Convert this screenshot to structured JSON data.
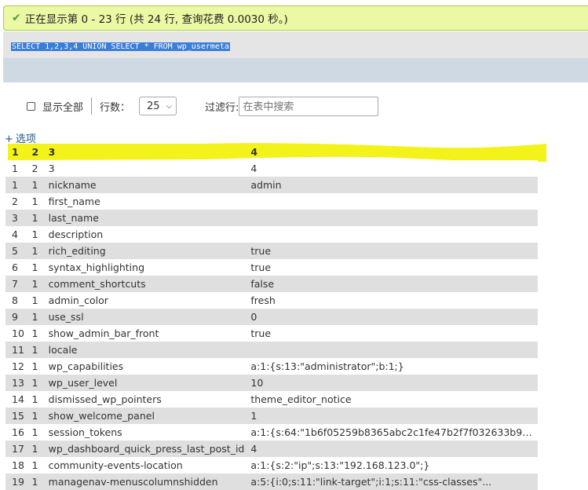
{
  "status": {
    "message": "正在显示第 0 - 23 行 (共 24 行, 查询花费 0.0030 秒。)"
  },
  "query": {
    "sql": "SELECT 1,2,3,4 UNION SELECT * FROM wp_usermeta"
  },
  "controls": {
    "show_all_label": "显示全部",
    "rows_label": "行数：",
    "rows_value": "25",
    "filter_label": "过滤行:",
    "filter_placeholder": "在表中搜索"
  },
  "options_link": {
    "plus": "+",
    "label": "选项"
  },
  "table": {
    "columns": [
      "1",
      "2",
      "3",
      "4"
    ],
    "rows": [
      [
        "1",
        "2",
        "3",
        "4"
      ],
      [
        "1",
        "1",
        "nickname",
        "admin"
      ],
      [
        "2",
        "1",
        "first_name",
        ""
      ],
      [
        "3",
        "1",
        "last_name",
        ""
      ],
      [
        "4",
        "1",
        "description",
        ""
      ],
      [
        "5",
        "1",
        "rich_editing",
        "true"
      ],
      [
        "6",
        "1",
        "syntax_highlighting",
        "true"
      ],
      [
        "7",
        "1",
        "comment_shortcuts",
        "false"
      ],
      [
        "8",
        "1",
        "admin_color",
        "fresh"
      ],
      [
        "9",
        "1",
        "use_ssl",
        "0"
      ],
      [
        "10",
        "1",
        "show_admin_bar_front",
        "true"
      ],
      [
        "11",
        "1",
        "locale",
        ""
      ],
      [
        "12",
        "1",
        "wp_capabilities",
        "a:1:{s:13:\"administrator\";b:1;}"
      ],
      [
        "13",
        "1",
        "wp_user_level",
        "10"
      ],
      [
        "14",
        "1",
        "dismissed_wp_pointers",
        "theme_editor_notice"
      ],
      [
        "15",
        "1",
        "show_welcome_panel",
        "1"
      ],
      [
        "16",
        "1",
        "session_tokens",
        "a:1:{s:64:\"1b6f05259b8365abc2c1fe47b2f7f032633b9fa..."
      ],
      [
        "17",
        "1",
        "wp_dashboard_quick_press_last_post_id",
        "4"
      ],
      [
        "18",
        "1",
        "community-events-location",
        "a:1:{s:2:\"ip\";s:13:\"192.168.123.0\";}"
      ],
      [
        "19",
        "1",
        "managenav-menuscolumnshidden",
        "a:5:{i:0;s:11:\"link-target\";i:1;s:11:\"css-classes\"..."
      ]
    ]
  },
  "colors": {
    "success_bg": "#ebf8a4",
    "success_border": "#a2d246",
    "highlight": "#f2f20a",
    "selection": "#3a7ed8",
    "row_even": "#dfdfdf"
  }
}
